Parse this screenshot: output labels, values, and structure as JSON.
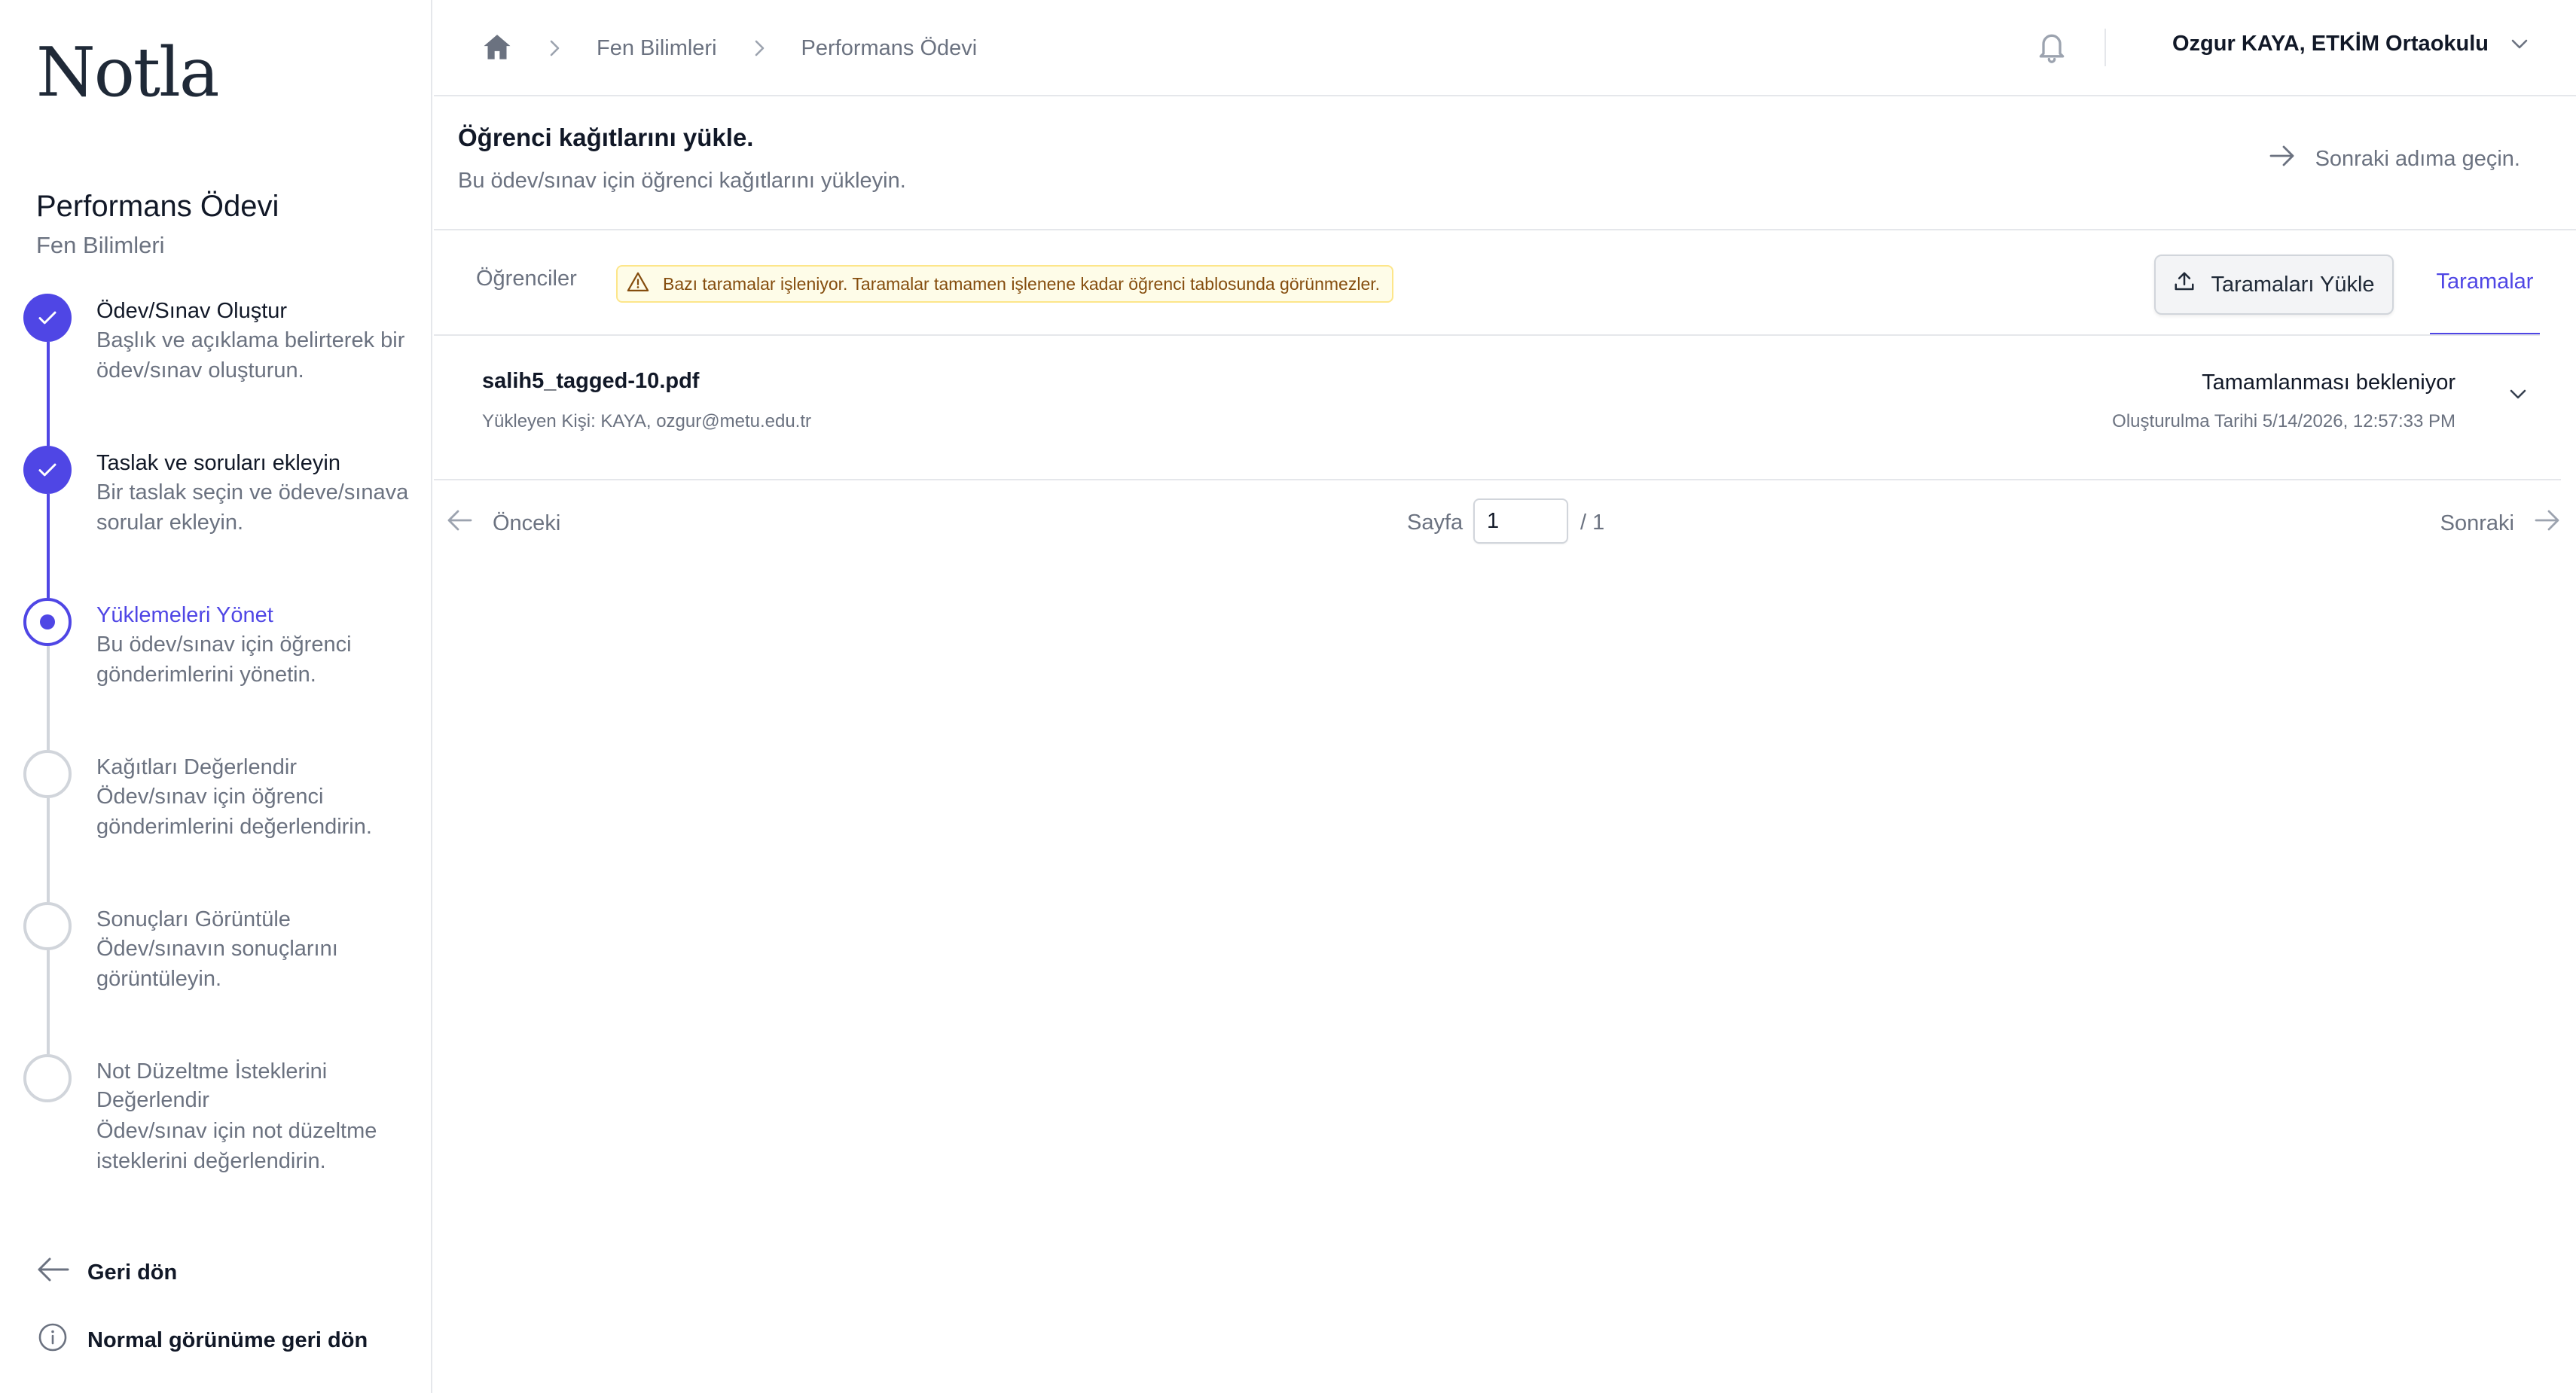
{
  "sidebar": {
    "logo": "Notla",
    "project_title": "Performans Ödevi",
    "project_subject": "Fen Bilimleri",
    "steps": [
      {
        "title": "Ödev/Sınav Oluştur",
        "desc": "Başlık ve açıklama belirterek bir ödev/sınav oluşturun.",
        "state": "done"
      },
      {
        "title": "Taslak ve soruları ekleyin",
        "desc": "Bir taslak seçin ve ödeve/sınava sorular ekleyin.",
        "state": "done"
      },
      {
        "title": "Yüklemeleri Yönet",
        "desc": "Bu ödev/sınav için öğrenci gönderimlerini yönetin.",
        "state": "current"
      },
      {
        "title": "Kağıtları Değerlendir",
        "desc": "Ödev/sınav için öğrenci gönderimlerini değerlendirin.",
        "state": "todo"
      },
      {
        "title": "Sonuçları Görüntüle",
        "desc": "Ödev/sınavın sonuçlarını görüntüleyin.",
        "state": "todo"
      },
      {
        "title": "Not Düzeltme İsteklerini Değerlendir",
        "desc": "Ödev/sınav için not düzeltme isteklerini değerlendirin.",
        "state": "todo"
      }
    ],
    "back_label": "Geri dön",
    "normal_view_label": "Normal görünüme geri dön"
  },
  "header": {
    "breadcrumb": [
      "Fen Bilimleri",
      "Performans Ödevi"
    ],
    "user_label": "Ozgur KAYA, ETKİM Ortaokulu"
  },
  "section": {
    "title": "Öğrenci kağıtlarını yükle.",
    "description": "Bu ödev/sınav için öğrenci kağıtlarını yükleyin.",
    "next_step_label": "Sonraki adıma geçin."
  },
  "tabs": {
    "students_label": "Öğrenciler",
    "warning_text": "Bazı taramalar işleniyor. Taramalar tamamen işlenene kadar öğrenci tablosunda görünmezler.",
    "upload_button_label": "Taramaları Yükle",
    "scans_label": "Taramalar"
  },
  "files": [
    {
      "name": "salih5_tagged-10.pdf",
      "uploader": "Yükleyen Kişi: KAYA, ozgur@metu.edu.tr",
      "status": "Tamamlanması bekleniyor",
      "created": "Oluşturulma Tarihi 5/14/2026, 12:57:33 PM"
    }
  ],
  "pagination": {
    "prev_label": "Önceki",
    "page_label": "Sayfa",
    "current_page": "1",
    "total_label": "/ 1",
    "next_label": "Sonraki"
  },
  "colors": {
    "accent": "#4f46e5",
    "warning_bg": "#fefce8",
    "warning_text": "#854d0e",
    "muted": "#6b7280"
  }
}
